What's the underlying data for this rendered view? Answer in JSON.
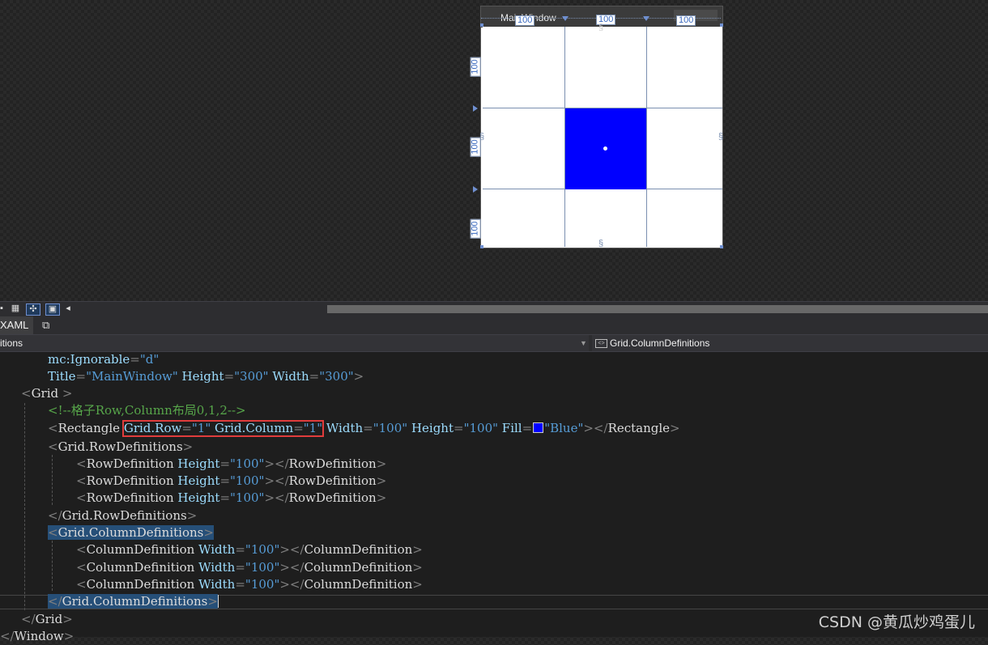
{
  "designer": {
    "window_title": "MainWindow",
    "rulers": {
      "top": [
        "100",
        "100",
        "100"
      ],
      "left": [
        "100",
        "100",
        "100"
      ]
    },
    "rect_fill": "#0000ff"
  },
  "toolbar": {
    "icons": [
      "grid-icon",
      "snap-icon",
      "element-icon",
      "scroll-left-icon"
    ]
  },
  "tabs": {
    "xaml_label": "XAML",
    "popout_icon": "popout-icon"
  },
  "navigation": {
    "left_label": "itions",
    "right_label": "Grid.ColumnDefinitions"
  },
  "code": {
    "l1": {
      "attr": "mc:Ignorable",
      "eq": "=",
      "val": "\"d\""
    },
    "l2": {
      "a1": "Title",
      "v1": "\"MainWindow\"",
      "a2": "Height",
      "v2": "\"300\"",
      "a3": "Width",
      "v3": "\"300\"",
      "close": ">"
    },
    "l3": {
      "open": "<",
      "elem": "Grid",
      "close": " >"
    },
    "l4": {
      "comment": "<!--格子Row,Column布局0,1,2-->"
    },
    "l5": {
      "open": "<",
      "elem": "Rectangle",
      "sp": " ",
      "a1": "Grid.Row",
      "eq": "=",
      "v1": "\"1\"",
      "a2": "Grid.Column",
      "v2": "\"1\"",
      "a3": "Width",
      "v3": "\"100\"",
      "a4": "Height",
      "v4": "\"100\"",
      "a5": "Fill",
      "v5": "\"Blue\"",
      "end_open": "></",
      "end_elem": "Rectangle",
      "end_close": ">"
    },
    "l6": {
      "text": "Grid.RowDefinitions"
    },
    "rowdef": {
      "elem": "RowDefinition",
      "attr": "Height",
      "val": "\"100\""
    },
    "l10": {
      "text": "Grid.RowDefinitions"
    },
    "l11": {
      "text": "Grid.ColumnDefinitions"
    },
    "coldef": {
      "elem": "ColumnDefinition",
      "attr": "Width",
      "val": "\"100\""
    },
    "l15": {
      "text": "Grid.ColumnDefinitions"
    },
    "l16": {
      "text": "Grid"
    },
    "l17": {
      "text": "Window"
    }
  },
  "watermark": "CSDN @黄瓜炒鸡蛋儿",
  "colors": {
    "attr": "#9cdcfe",
    "value": "#569cd6",
    "comment": "#57a64a",
    "highlight": "#e03c3c"
  }
}
